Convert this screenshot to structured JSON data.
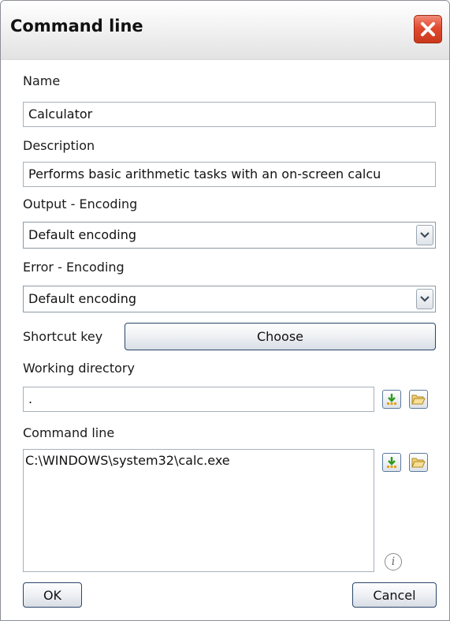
{
  "window": {
    "title": "Command line",
    "close_icon": "close-icon"
  },
  "form": {
    "name_label": "Name",
    "name_value": "Calculator",
    "description_label": "Description",
    "description_value": "Performs basic arithmetic tasks with an on-screen calcu",
    "output_encoding_label": "Output - Encoding",
    "output_encoding_value": "Default encoding",
    "error_encoding_label": "Error - Encoding",
    "error_encoding_value": "Default encoding",
    "shortcut_label": "Shortcut key",
    "shortcut_button": "Choose",
    "working_dir_label": "Working directory",
    "working_dir_value": ".",
    "command_line_label": "Command line",
    "command_line_value": "C:\\WINDOWS\\system32\\calc.exe"
  },
  "buttons": {
    "ok": "OK",
    "cancel": "Cancel"
  },
  "icons": {
    "insert": "insert-arrow-icon",
    "browse": "folder-open-icon",
    "info": "info-icon"
  },
  "colors": {
    "close_button": "#e14a2e",
    "button_border": "#28466a"
  }
}
